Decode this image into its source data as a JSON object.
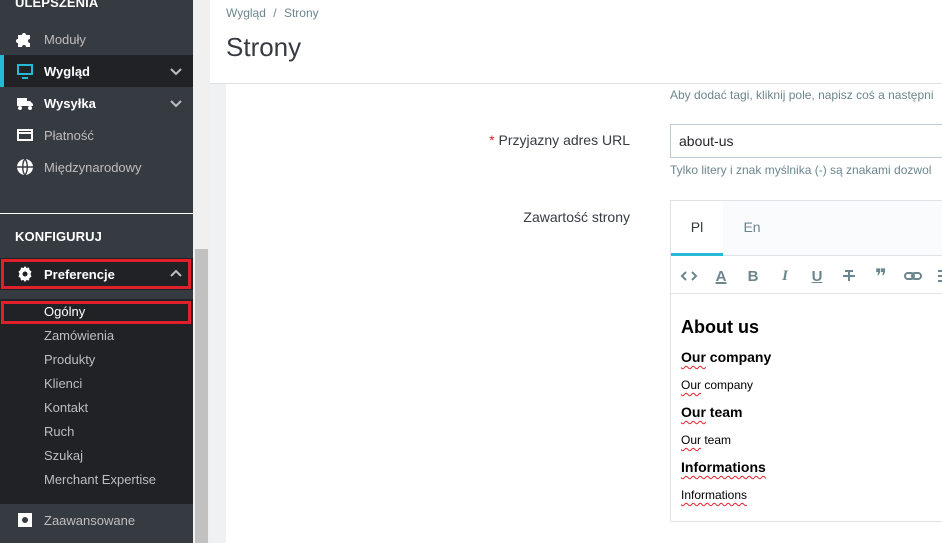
{
  "sidebar": {
    "section_upgrades": "ULEPSZENIA",
    "items": [
      {
        "label": "Moduły",
        "icon": "puzzle-icon"
      },
      {
        "label": "Wygląd",
        "icon": "monitor-icon"
      },
      {
        "label": "Wysyłka",
        "icon": "truck-icon"
      },
      {
        "label": "Płatność",
        "icon": "credit-card-icon"
      },
      {
        "label": "Międzynarodowy",
        "icon": "globe-icon"
      }
    ],
    "section_configure": "KONFIGURUJ",
    "preferences": {
      "label": "Preferencje",
      "icon": "gear-icon"
    },
    "sub_items": [
      "Ogólny",
      "Zamówienia",
      "Produkty",
      "Klienci",
      "Kontakt",
      "Ruch",
      "Szukaj",
      "Merchant Expertise"
    ],
    "advanced": {
      "label": "Zaawansowane",
      "icon": "gear-box-icon"
    }
  },
  "header": {
    "breadcrumb": [
      "Wygląd",
      "Strony"
    ],
    "breadcrumb_sep": "/",
    "title": "Strony"
  },
  "form": {
    "tags_hint": "Aby dodać tagi, kliknij pole, napisz coś a następni",
    "url_required": "*",
    "url_label": "Przyjazny adres URL",
    "url_value": "about-us",
    "url_hint": "Tylko litery i znak myślnika (-) są znakami dozwol",
    "content_label": "Zawartość strony",
    "tabs": [
      "Pl",
      "En"
    ],
    "toolbar": [
      "code-icon",
      "text-color-icon",
      "bold-icon",
      "italic-icon",
      "underline-icon",
      "strikethrough-icon",
      "quote-icon",
      "link-icon",
      "list-icon"
    ],
    "editor": {
      "h1": "About us",
      "sections": [
        {
          "heading": "Our company",
          "heading_spell": "Our",
          "heading_rest": " company",
          "text_spell": "Our",
          "text_rest": " company"
        },
        {
          "heading": "Our team",
          "heading_spell": "Our",
          "heading_rest": " team",
          "text_spell": "Our",
          "text_rest": " team"
        },
        {
          "heading": "Informations",
          "heading_spell": "Informations",
          "heading_rest": "",
          "text_spell": "Informations",
          "text_rest": ""
        }
      ]
    }
  },
  "colors": {
    "accent": "#25b9d7",
    "highlight": "#e2202a",
    "sidebar": "#363a41"
  }
}
